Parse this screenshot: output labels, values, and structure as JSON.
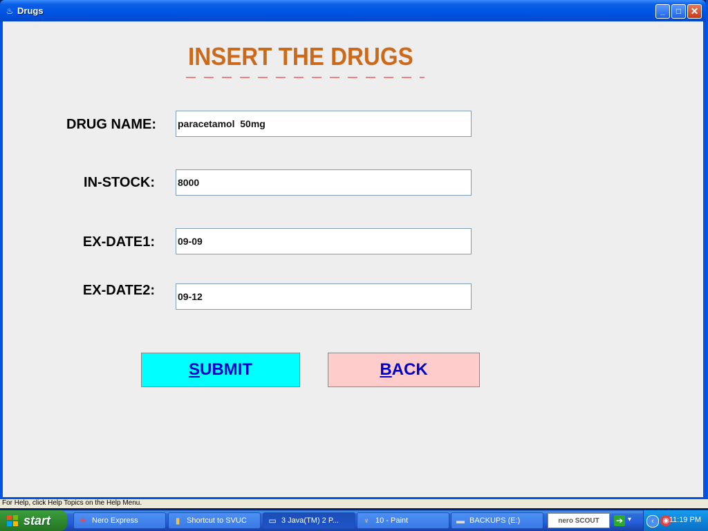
{
  "window": {
    "title": "Drugs",
    "title_icon": "java-cup-icon"
  },
  "form": {
    "heading": "INSERT THE DRUGS",
    "fields": [
      {
        "label": "DRUG NAME:",
        "value": "paracetamol  50mg"
      },
      {
        "label": "IN-STOCK:",
        "value": "8000"
      },
      {
        "label": "EX-DATE1:",
        "value": "09-09"
      },
      {
        "label": "EX-DATE2:",
        "value": "09-12"
      }
    ],
    "submit_mnemonic": "S",
    "submit_rest": "UBMIT",
    "back_mnemonic": "B",
    "back_rest": "ACK",
    "colors": {
      "heading": "#cc6a1c",
      "submit_bg": "#00ffff",
      "back_bg": "#ffcccc",
      "button_text": "#0000cc"
    }
  },
  "statusbar": {
    "text": "For Help, click Help Topics on the Help Menu."
  },
  "taskbar": {
    "start_label": "start",
    "tasks": [
      {
        "label": "Nero Express",
        "icon": "nero-icon"
      },
      {
        "label": "Shortcut to SVUC",
        "icon": "shortcut-icon"
      },
      {
        "label": "3 Java(TM) 2 P...",
        "icon": "java-icon"
      },
      {
        "label": "10 - Paint",
        "icon": "paint-icon"
      },
      {
        "label": "BACKUPS (E:)",
        "icon": "drive-icon"
      }
    ],
    "nero_scout": "nero SCOUT",
    "clock": "11:19 PM"
  }
}
